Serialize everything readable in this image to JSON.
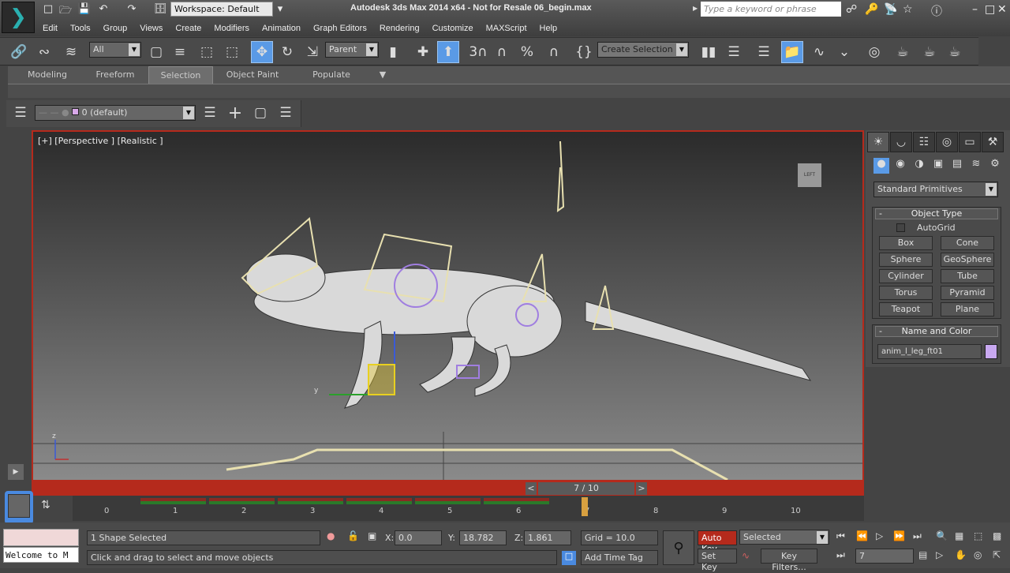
{
  "title_bar": {
    "app_title": "Autodesk 3ds Max  2014 x64  - Not for Resale   06_begin.max",
    "workspace": "Workspace: Default",
    "search_placeholder": "Type a keyword or phrase"
  },
  "menu": [
    "Edit",
    "Tools",
    "Group",
    "Views",
    "Create",
    "Modifiers",
    "Animation",
    "Graph Editors",
    "Rendering",
    "Customize",
    "MAXScript",
    "Help"
  ],
  "main_toolbar": {
    "selection_filter": "All",
    "reference_coord": "Parent",
    "snap_label": "3",
    "named_selection": "Create Selection Set"
  },
  "ribbon": {
    "tabs": [
      "Modeling",
      "Freeform",
      "Selection",
      "Object Paint",
      "Populate"
    ],
    "active_tab": "Selection"
  },
  "layer_toolbar": {
    "current_layer": "0 (default)",
    "layer_color": "#d8a8e8"
  },
  "viewport": {
    "label": "[+] [Perspective ] [Realistic ]",
    "viewcube_label": "LEFT",
    "axis_labels": {
      "x": "x",
      "y": "y",
      "z": "z"
    },
    "border_color": "#b52a1c"
  },
  "command_panel": {
    "category": "Standard Primitives",
    "object_type": {
      "title": "Object Type",
      "autogrid": "AutoGrid",
      "autogrid_checked": false,
      "buttons": [
        "Box",
        "Cone",
        "Sphere",
        "GeoSphere",
        "Cylinder",
        "Tube",
        "Torus",
        "Pyramid",
        "Teapot",
        "Plane"
      ]
    },
    "name_and_color": {
      "title": "Name and Color",
      "name": "anim_l_leg_ft01",
      "color": "#c8a8f0"
    },
    "collapse_symbol": "-"
  },
  "time_slider": {
    "label": "7 / 10",
    "prev": "<",
    "next": ">",
    "current_frame": 7,
    "total_frames": 10
  },
  "track_bar": {
    "ticks": [
      "0",
      "1",
      "2",
      "3",
      "4",
      "5",
      "6",
      "7",
      "8",
      "9",
      "10"
    ]
  },
  "status": {
    "maxscript_listener": "Welcome to M",
    "selection_status": "1 Shape Selected",
    "prompt": "Click and drag to select and move objects",
    "x_label": "X:",
    "x": "0.0",
    "y_label": "Y:",
    "y": "18.782",
    "z_label": "Z:",
    "z": "1.861",
    "grid": "Grid = 10.0",
    "add_time_tag": "Add Time Tag"
  },
  "animation": {
    "auto_key": "Auto Key",
    "set_key": "Set Key",
    "key_mode": "Selected",
    "key_filters": "Key Filters...",
    "current_frame": "7",
    "auto_key_color": "#b52a1c"
  }
}
